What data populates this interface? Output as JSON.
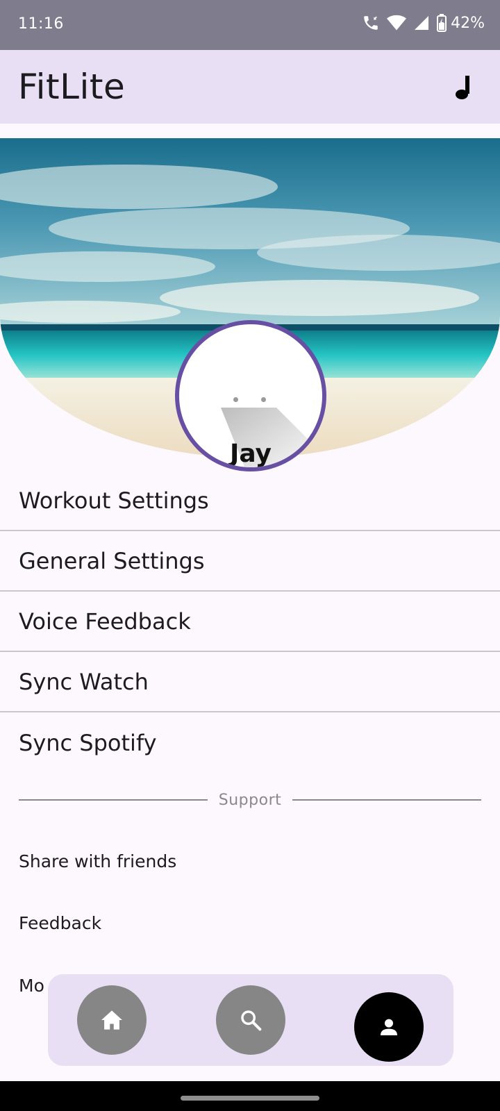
{
  "status_bar": {
    "time": "11:16",
    "battery": "42%"
  },
  "app_bar": {
    "title": "FitLite",
    "music_icon": "music-note-icon"
  },
  "profile": {
    "name": "Jay"
  },
  "settings": {
    "items": [
      {
        "label": "Workout Settings"
      },
      {
        "label": "General Settings"
      },
      {
        "label": "Voice Feedback"
      },
      {
        "label": "Sync Watch"
      },
      {
        "label": "Sync Spotify"
      }
    ]
  },
  "support": {
    "header": "Support",
    "items": [
      {
        "label": "Share with friends"
      },
      {
        "label": "Feedback"
      },
      {
        "label": "Mo"
      }
    ]
  },
  "bottom_nav": {
    "items": [
      {
        "icon": "home-icon",
        "active": false
      },
      {
        "icon": "search-icon",
        "active": false
      },
      {
        "icon": "person-icon",
        "active": true
      }
    ]
  },
  "colors": {
    "accent": "#6750a4",
    "app_bar_bg": "#e8dff5",
    "status_bar_bg": "#7e7c8d",
    "nav_inactive": "#868686",
    "nav_active": "#000000"
  }
}
